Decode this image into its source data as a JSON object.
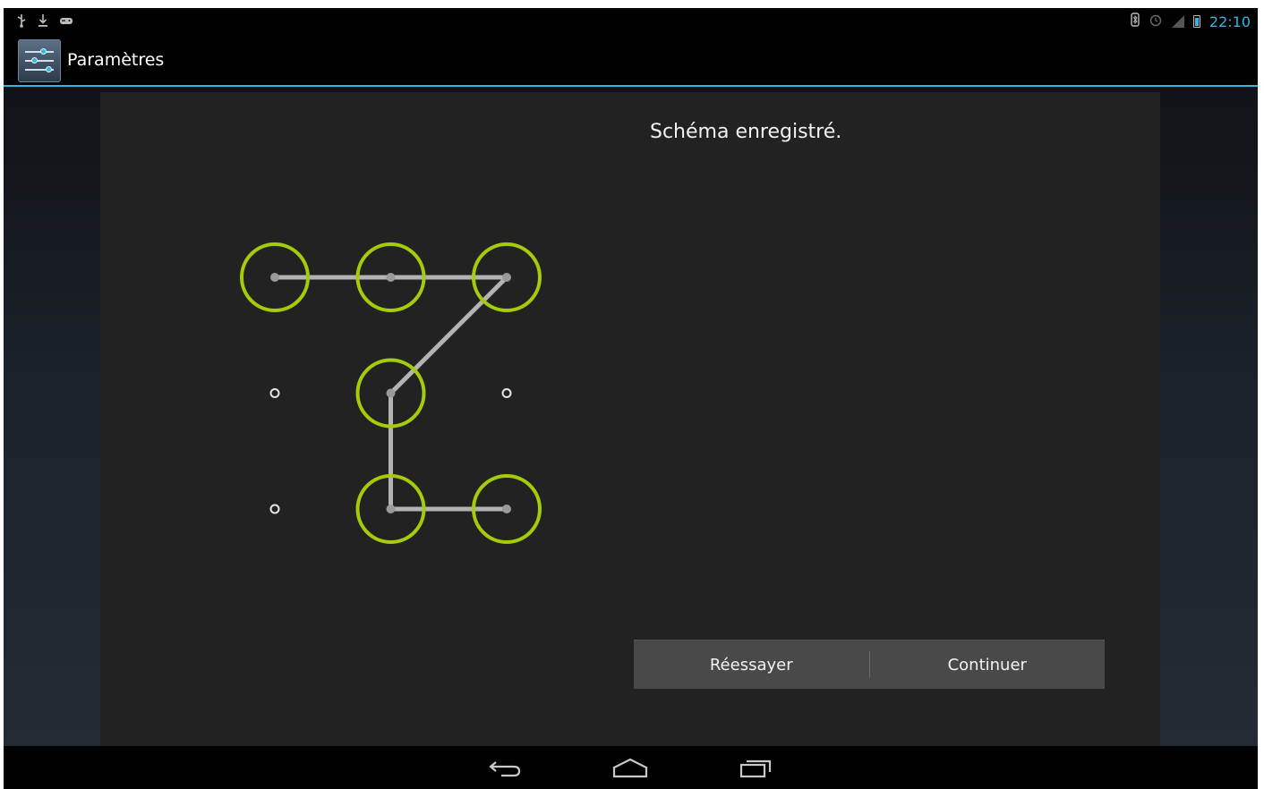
{
  "status_bar": {
    "left_icons": [
      "usb-icon",
      "download-icon",
      "gamepad-icon"
    ],
    "right_icons": [
      "bluetooth-icon",
      "alarm-icon",
      "signal-icon",
      "battery-icon"
    ],
    "time": "22:10"
  },
  "action_bar": {
    "app_icon": "settings-icon",
    "title": "Paramètres"
  },
  "pattern_screen": {
    "message": "Schéma enregistré.",
    "grid_rows": 3,
    "grid_cols": 3,
    "selected_sequence": [
      0,
      1,
      2,
      4,
      7,
      8
    ],
    "accent_color": "#a5cc0a",
    "line_color": "#b3b3b3"
  },
  "buttons": {
    "retry_label": "Réessayer",
    "continue_label": "Continuer"
  },
  "navigation": {
    "icons": [
      "back-icon",
      "home-icon",
      "recent-apps-icon"
    ]
  },
  "colors": {
    "holo_blue": "#33b5e5",
    "panel": "#222222"
  }
}
